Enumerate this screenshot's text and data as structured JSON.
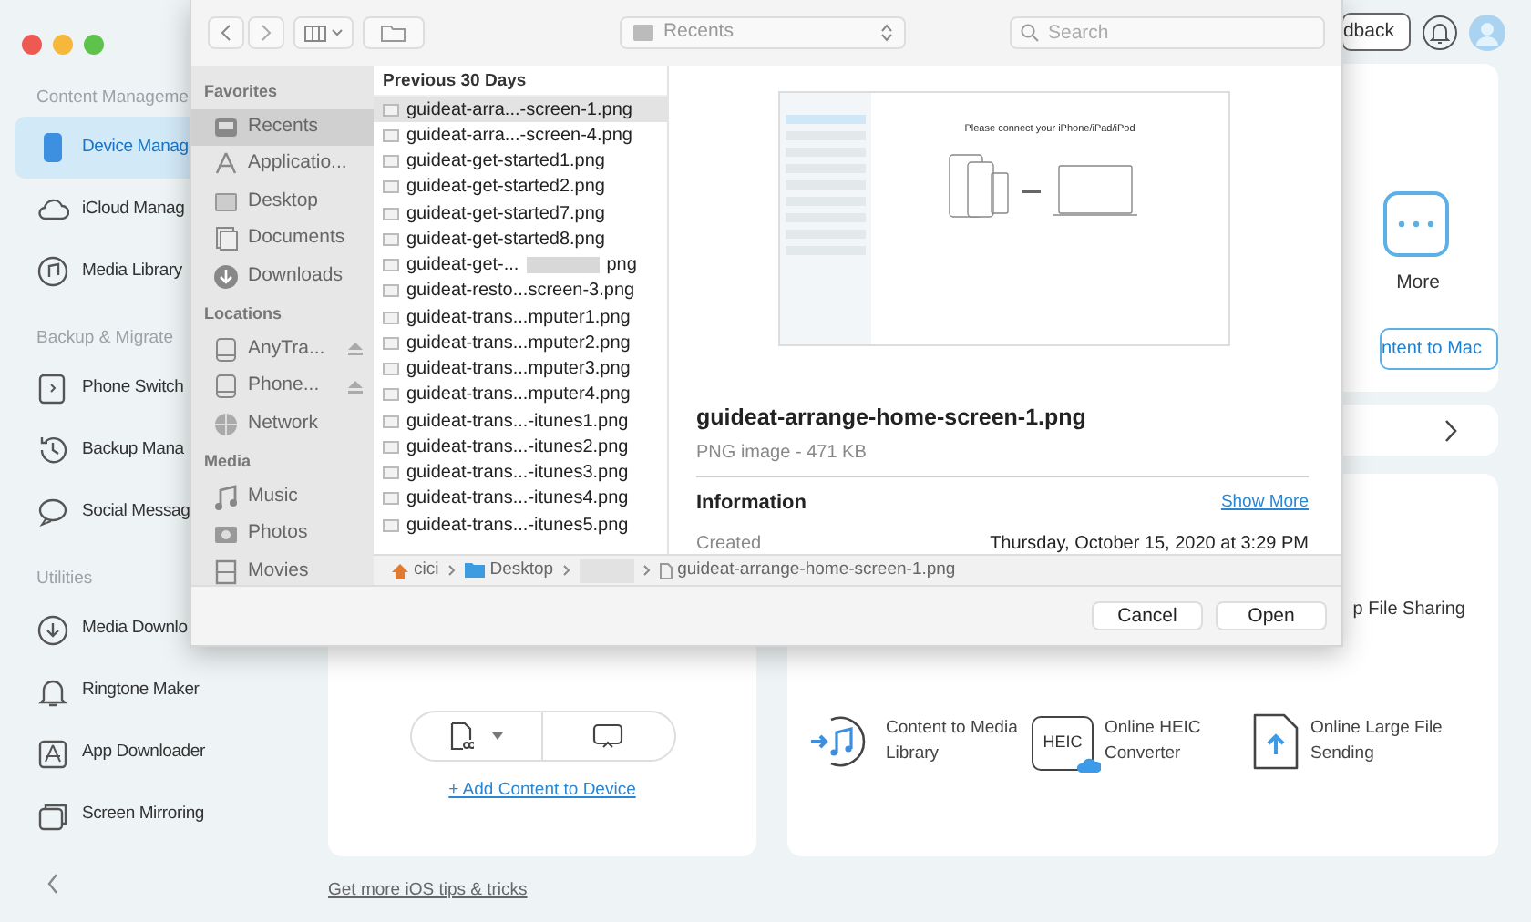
{
  "app": {
    "sidebar": [
      {
        "title": "Content Manageme",
        "items": [
          {
            "label": "Device Manag",
            "selected": true
          },
          {
            "label": "iCloud Manag",
            "selected": false
          },
          {
            "label": "Media Library",
            "selected": false
          }
        ]
      },
      {
        "title": "Backup & Migrate",
        "items": [
          {
            "label": "Phone Switch",
            "selected": false
          },
          {
            "label": "Backup Mana",
            "selected": false
          },
          {
            "label": "Social Messag",
            "selected": false
          }
        ]
      },
      {
        "title": "Utilities",
        "items": [
          {
            "label": "Media Downlo",
            "selected": false
          },
          {
            "label": "Ringtone Maker",
            "selected": false
          },
          {
            "label": "App Downloader",
            "selected": false
          },
          {
            "label": "Screen Mirroring",
            "selected": false
          }
        ]
      }
    ],
    "header": {
      "feedback": "dback"
    },
    "top_card": {
      "more_label": "More",
      "button": "ntent to Mac"
    },
    "left_card": {
      "link": "+ Add Content to Device"
    },
    "right_card": {
      "partial_label": "p File Sharing",
      "tools": [
        {
          "label": "Content to Media Library"
        },
        {
          "label": "Online HEIC Converter",
          "badge": "HEIC"
        },
        {
          "label": "Online Large File Sending"
        }
      ]
    },
    "footer_link": "Get more iOS tips & tricks"
  },
  "dialog": {
    "location": "Recents",
    "search": {
      "placeholder": "Search"
    },
    "sidebar": [
      {
        "title": "Favorites",
        "items": [
          {
            "label": "Recents",
            "selected": true,
            "eject": false
          },
          {
            "label": "Applicatio...",
            "selected": false,
            "eject": false
          },
          {
            "label": "Desktop",
            "selected": false,
            "eject": false
          },
          {
            "label": "Documents",
            "selected": false,
            "eject": false
          },
          {
            "label": "Downloads",
            "selected": false,
            "eject": false
          }
        ]
      },
      {
        "title": "Locations",
        "items": [
          {
            "label": "AnyTra...",
            "selected": false,
            "eject": true
          },
          {
            "label": "Phone...",
            "selected": false,
            "eject": true
          },
          {
            "label": "Network",
            "selected": false,
            "eject": false
          }
        ]
      },
      {
        "title": "Media",
        "items": [
          {
            "label": "Music",
            "selected": false,
            "eject": false
          },
          {
            "label": "Photos",
            "selected": false,
            "eject": false
          },
          {
            "label": "Movies",
            "selected": false,
            "eject": false
          }
        ]
      }
    ],
    "list": {
      "group": "Previous 30 Days",
      "files": [
        {
          "name": "guideat-arra...-screen-1.png",
          "selected": true
        },
        {
          "name": "guideat-arra...-screen-4.png",
          "selected": false
        },
        {
          "name": "guideat-get-started1.png",
          "selected": false
        },
        {
          "name": "guideat-get-started2.png",
          "selected": false
        },
        {
          "name": "guideat-get-started7.png",
          "selected": false
        },
        {
          "name": "guideat-get-started8.png",
          "selected": false
        },
        {
          "name": "guideat-get-...",
          "suffix": "png",
          "selected": false
        },
        {
          "name": "guideat-resto...screen-3.png",
          "selected": false
        },
        {
          "name": "guideat-trans...mputer1.png",
          "selected": false
        },
        {
          "name": "guideat-trans...mputer2.png",
          "selected": false
        },
        {
          "name": "guideat-trans...mputer3.png",
          "selected": false
        },
        {
          "name": "guideat-trans...mputer4.png",
          "selected": false
        },
        {
          "name": "guideat-trans...-itunes1.png",
          "selected": false
        },
        {
          "name": "guideat-trans...-itunes2.png",
          "selected": false
        },
        {
          "name": "guideat-trans...-itunes3.png",
          "selected": false
        },
        {
          "name": "guideat-trans...-itunes4.png",
          "selected": false
        },
        {
          "name": "guideat-trans...-itunes5.png",
          "selected": false
        }
      ]
    },
    "preview": {
      "thumbnail_title": "Please connect your iPhone/iPad/iPod",
      "name": "guideat-arrange-home-screen-1.png",
      "kind": "PNG image - 471 KB",
      "info_title": "Information",
      "show_more": "Show More",
      "rows": [
        {
          "label": "Created",
          "value": "Thursday, October 15, 2020 at 3:29 PM"
        }
      ]
    },
    "path": [
      {
        "kind": "home",
        "label": "cici"
      },
      {
        "kind": "folder",
        "label": "Desktop"
      },
      {
        "kind": "redacted"
      },
      {
        "kind": "file",
        "label": "guideat-arrange-home-screen-1.png"
      }
    ],
    "buttons": [
      {
        "label": "Cancel"
      },
      {
        "label": "Open"
      }
    ]
  }
}
